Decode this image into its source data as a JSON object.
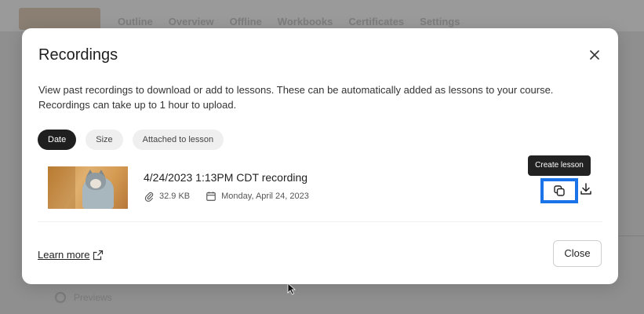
{
  "background": {
    "tabs": [
      "Outline",
      "Overview",
      "Offline",
      "Workbooks",
      "Certificates",
      "Settings"
    ],
    "bottom_item": "Previews"
  },
  "modal": {
    "title": "Recordings",
    "close_icon": "close-icon",
    "description_line1": "View past recordings to download or add to lessons. These can be automatically added as lessons to your course.",
    "description_line2": "Recordings can take up to 1 hour to upload.",
    "filters": [
      {
        "label": "Date",
        "active": true
      },
      {
        "label": "Size",
        "active": false
      },
      {
        "label": "Attached to lesson",
        "active": false
      }
    ],
    "recording": {
      "title": "4/24/2023 1:13PM CDT recording",
      "size": "32.9 KB",
      "date": "Monday, April 24, 2023"
    },
    "tooltip": "Create lesson",
    "learn_more": "Learn more",
    "close_button": "Close"
  },
  "colors": {
    "accent": "#1a73e8",
    "chip_active": "#1f1f1f",
    "tooltip_bg": "#222222"
  }
}
